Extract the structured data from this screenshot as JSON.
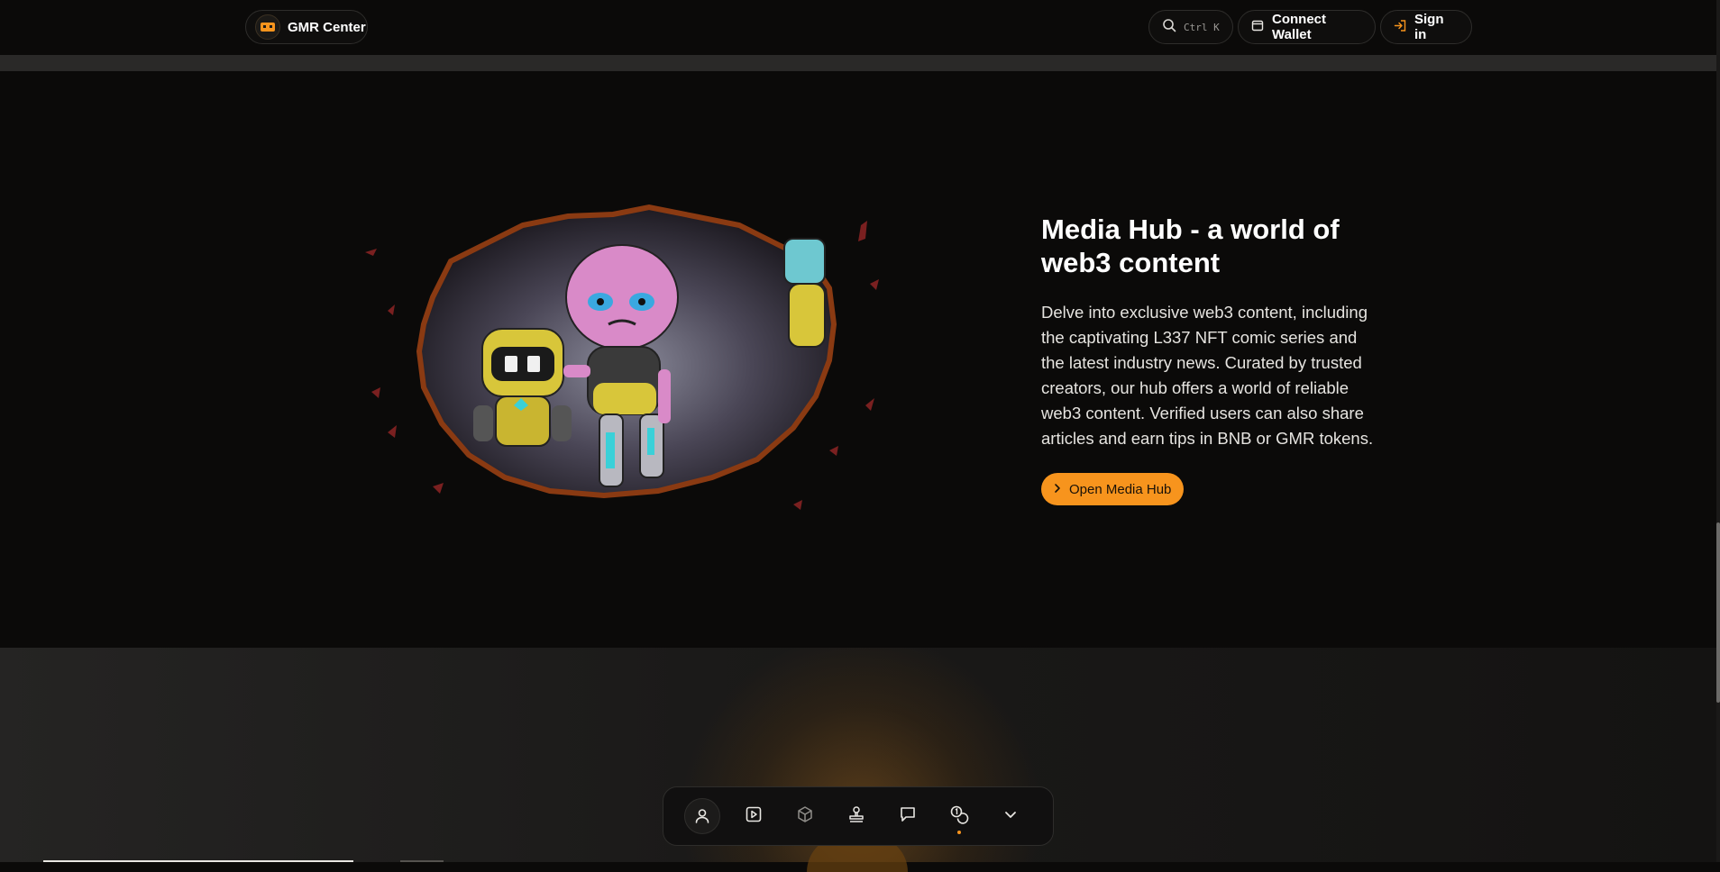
{
  "header": {
    "brand": "GMR Center",
    "search_shortcut": "Ctrl K",
    "connect_wallet_label": "Connect Wallet",
    "sign_in_label": "Sign in",
    "search_icon": "search-icon",
    "wallet_icon": "wallet-icon",
    "sign_in_icon": "sign-in-icon"
  },
  "hero": {
    "title": "Media Hub - a world of web3 content",
    "description": "Delve into exclusive web3 content, including the captivating L337 NFT comic series and the latest industry news. Curated by trusted creators, our hub offers a world of reliable web3 content. Verified users can also share articles and earn tips in BNB or GMR tokens.",
    "cta_label": "Open Media Hub",
    "cta_icon": "chevron-right-icon"
  },
  "dock": {
    "items": [
      {
        "icon": "user-icon",
        "active": true
      },
      {
        "icon": "play-square-icon"
      },
      {
        "icon": "cube-icon"
      },
      {
        "icon": "stamp-icon"
      },
      {
        "icon": "chat-icon"
      },
      {
        "icon": "coins-icon",
        "indicator": true
      },
      {
        "icon": "chevron-down-icon"
      }
    ]
  },
  "colors": {
    "accent": "#f7941d",
    "background": "#0b0a09",
    "border": "#2e2d2b"
  }
}
